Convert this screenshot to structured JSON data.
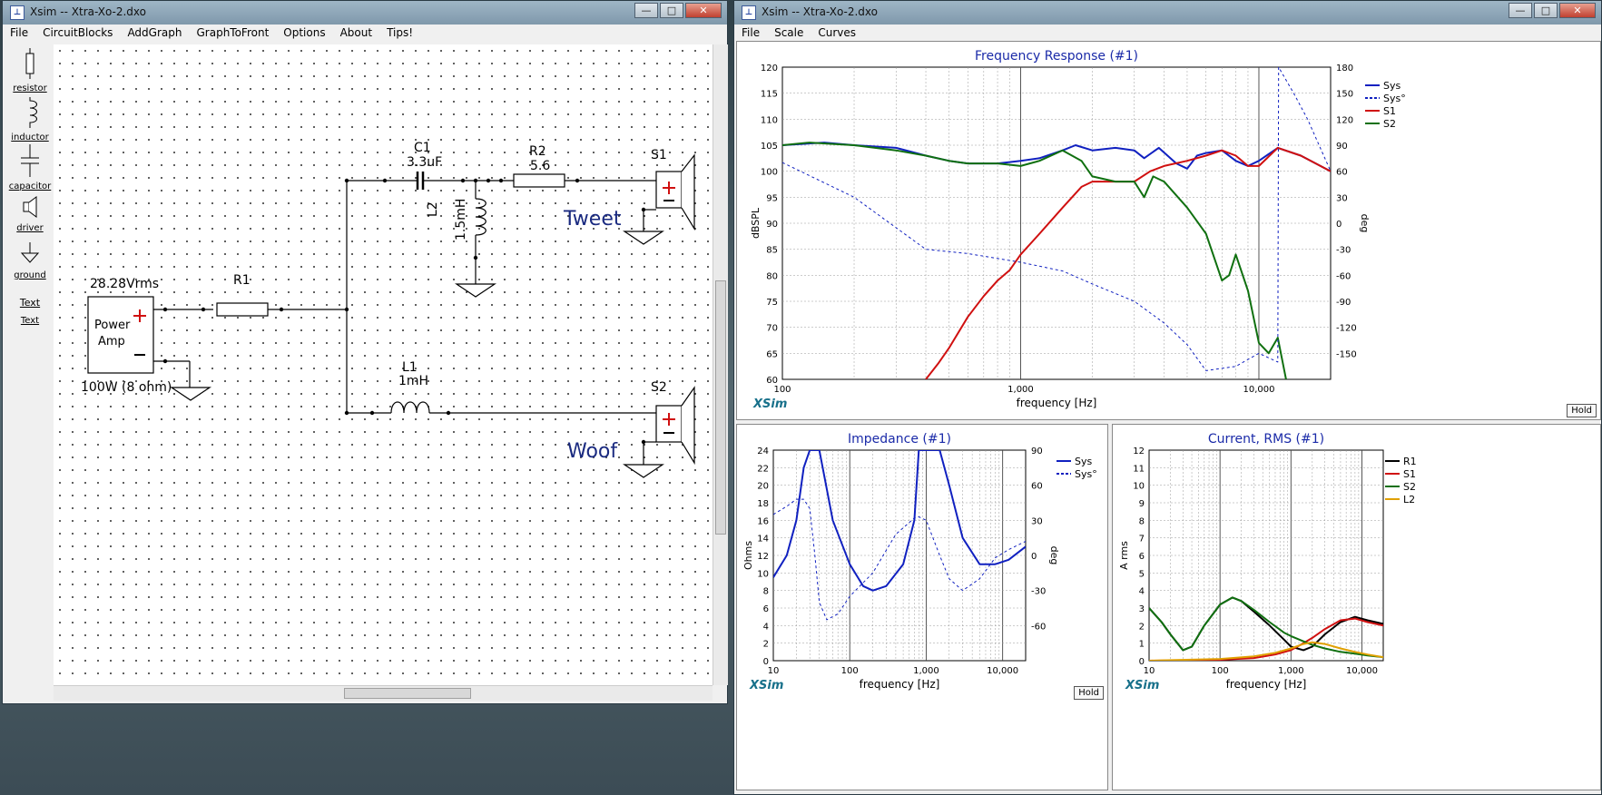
{
  "desktop": {
    "left_window_title": "Xsim -- Xtra-Xo-2.dxo",
    "right_window_title": "Xsim -- Xtra-Xo-2.dxo"
  },
  "left_menu": [
    "File",
    "CircuitBlocks",
    "AddGraph",
    "GraphToFront",
    "Options",
    "About",
    "Tips!"
  ],
  "right_menu": [
    "File",
    "Scale",
    "Curves"
  ],
  "window_buttons": {
    "minimize": "—",
    "maximize": "□",
    "close": "✕"
  },
  "toolbox": [
    "resistor",
    "inductor",
    "capacitor",
    "driver",
    "ground",
    "Text"
  ],
  "toolbox_text_sample": "Text",
  "schematic": {
    "source_voltage": "28.28Vrms",
    "source_name": "Power",
    "source_name2": "Amp",
    "source_rating": "100W (8 ohm)",
    "r1": "R1",
    "c1": "C1",
    "c1_value": "3.3uF",
    "r2": "R2",
    "r2_value": "5.6",
    "l2": "L2",
    "l2_value": "1.5mH",
    "l1": "L1",
    "l1_value": "1mH",
    "s1": "S1",
    "s2": "S2",
    "tweet": "Tweet",
    "woof": "Woof"
  },
  "freq_graph": {
    "title": "Frequency Response (#1)",
    "xlabel": "frequency [Hz]",
    "ylabel": "dBSPL",
    "y2label": "deg",
    "brand": "XSim",
    "hold": "Hold",
    "xticks": [
      "100",
      "1,000",
      "10,000"
    ],
    "yticks": [
      "120",
      "115",
      "110",
      "105",
      "100",
      "95",
      "90",
      "85",
      "80",
      "75",
      "70",
      "65",
      "60"
    ],
    "y2ticks": [
      "180",
      "150",
      "120",
      "90",
      "60",
      "30",
      "0",
      "-30",
      "-60",
      "-90",
      "-120",
      "-150"
    ],
    "legend": [
      "Sys",
      "Sys°",
      "S1",
      "S2"
    ]
  },
  "imp_graph": {
    "title": "Impedance (#1)",
    "xlabel": "frequency [Hz]",
    "ylabel": "Ohms",
    "y2label": "deg",
    "brand": "XSim",
    "hold": "Hold",
    "xticks": [
      "10",
      "100",
      "1,000",
      "10,000"
    ],
    "yticks": [
      "24",
      "22",
      "20",
      "18",
      "16",
      "14",
      "12",
      "10",
      "8",
      "6",
      "4",
      "2",
      "0"
    ],
    "y2ticks": [
      "90",
      "60",
      "30",
      "0",
      "-30",
      "-60"
    ],
    "legend": [
      "Sys",
      "Sys°"
    ]
  },
  "cur_graph": {
    "title": "Current, RMS (#1)",
    "xlabel": "frequency [Hz]",
    "ylabel": "A rms",
    "brand": "XSim",
    "xticks": [
      "10",
      "100",
      "1,000",
      "10,000"
    ],
    "yticks": [
      "12",
      "11",
      "10",
      "9",
      "8",
      "7",
      "6",
      "5",
      "4",
      "3",
      "2",
      "1",
      "0"
    ],
    "legend": [
      "R1",
      "S1",
      "S2",
      "L2"
    ]
  },
  "colors": {
    "sys": "#1020c0",
    "s1": "#d01010",
    "s2": "#107010",
    "l2": "#e0a000",
    "r1": "#000000",
    "title": "#1a2aa8"
  },
  "chart_data": [
    {
      "type": "line",
      "title": "Frequency Response (#1)",
      "xlabel": "frequency [Hz]",
      "ylabel": "dBSPL",
      "y2label": "deg",
      "xscale": "log",
      "xlim": [
        100,
        20000
      ],
      "ylim": [
        60,
        120
      ],
      "y2lim": [
        -180,
        180
      ],
      "legend": "top-right",
      "grid": true,
      "series": [
        {
          "name": "Sys",
          "axis": "left",
          "x": [
            100,
            150,
            200,
            300,
            400,
            500,
            600,
            800,
            1000,
            1200,
            1500,
            1700,
            2000,
            2500,
            3000,
            3300,
            3800,
            4500,
            5000,
            5500,
            6000,
            7000,
            8000,
            9000,
            10000,
            12000,
            15000,
            20000
          ],
          "y": [
            105,
            105.5,
            105,
            104.5,
            103,
            102,
            101.5,
            101.5,
            102,
            102.5,
            104,
            105,
            104,
            104.5,
            104,
            102.5,
            104.5,
            101.5,
            100.5,
            103,
            103.5,
            104,
            102,
            101,
            102,
            104.5,
            103,
            100
          ]
        },
        {
          "name": "S1",
          "axis": "left",
          "x": [
            400,
            450,
            500,
            600,
            700,
            800,
            900,
            1000,
            1200,
            1500,
            1800,
            2000,
            2500,
            3000,
            3500,
            4000,
            5000,
            6000,
            7000,
            8000,
            9000,
            10000,
            12000,
            15000,
            20000
          ],
          "y": [
            60,
            63,
            66,
            72,
            76,
            79,
            81,
            84,
            88,
            93,
            97,
            98,
            98,
            98,
            100,
            101,
            102,
            103,
            104,
            103,
            101,
            101,
            104.5,
            103,
            100
          ]
        },
        {
          "name": "S2",
          "axis": "left",
          "x": [
            100,
            130,
            200,
            300,
            400,
            500,
            600,
            800,
            1000,
            1200,
            1500,
            1800,
            2000,
            2500,
            3000,
            3300,
            3600,
            4000,
            5000,
            6000,
            7000,
            7500,
            8000,
            9000,
            10000,
            11000,
            12000,
            13000
          ],
          "y": [
            105,
            105.5,
            105,
            104,
            103,
            102,
            101.5,
            101.5,
            101,
            102,
            104,
            102,
            99,
            98,
            98,
            95,
            99,
            98,
            93,
            88,
            79,
            80,
            84,
            77,
            67,
            65,
            68,
            60
          ]
        },
        {
          "name": "Sys°",
          "axis": "right",
          "x": [
            100,
            200,
            400,
            600,
            1000,
            1500,
            2000,
            3000,
            4000,
            5000,
            6000,
            8000,
            10000,
            12000,
            12100,
            14000,
            16000,
            20000
          ],
          "y": [
            70,
            30,
            -30,
            -35,
            -45,
            -55,
            -70,
            -90,
            -115,
            -140,
            -170,
            -165,
            -150,
            -160,
            180,
            150,
            120,
            60
          ]
        }
      ]
    },
    {
      "type": "line",
      "title": "Impedance (#1)",
      "xlabel": "frequency [Hz]",
      "ylabel": "Ohms",
      "y2label": "deg",
      "xscale": "log",
      "xlim": [
        10,
        20000
      ],
      "ylim": [
        0,
        24
      ],
      "y2lim": [
        -90,
        90
      ],
      "legend": "top-right",
      "grid": true,
      "series": [
        {
          "name": "Sys",
          "axis": "left",
          "x": [
            10,
            15,
            20,
            25,
            30,
            40,
            60,
            100,
            150,
            200,
            300,
            500,
            700,
            800,
            1000,
            1500,
            2000,
            3000,
            5000,
            8000,
            12000,
            20000
          ],
          "y": [
            9.5,
            12,
            16,
            22,
            24,
            24,
            16,
            11,
            8.5,
            8,
            8.5,
            11,
            16,
            24,
            24,
            24,
            20,
            14,
            11,
            11,
            11.5,
            13
          ]
        },
        {
          "name": "Sys°",
          "axis": "right",
          "x": [
            10,
            15,
            20,
            25,
            30,
            35,
            40,
            50,
            70,
            100,
            200,
            400,
            700,
            800,
            1000,
            1500,
            2000,
            3000,
            5000,
            8000,
            12000,
            20000
          ],
          "y": [
            35,
            42,
            48,
            48,
            40,
            0,
            -40,
            -55,
            -50,
            -35,
            -15,
            18,
            32,
            33,
            30,
            0,
            -20,
            -30,
            -20,
            -2,
            5,
            12
          ]
        }
      ]
    },
    {
      "type": "line",
      "title": "Current, RMS (#1)",
      "xlabel": "frequency [Hz]",
      "ylabel": "A rms",
      "xscale": "log",
      "xlim": [
        10,
        20000
      ],
      "ylim": [
        0,
        12
      ],
      "legend": "top-right",
      "grid": true,
      "series": [
        {
          "name": "R1",
          "x": [
            10,
            15,
            20,
            30,
            40,
            60,
            100,
            150,
            200,
            300,
            500,
            800,
            1000,
            1500,
            2000,
            3000,
            5000,
            8000,
            12000,
            20000
          ],
          "y": [
            3,
            2.2,
            1.5,
            0.6,
            0.8,
            2,
            3.2,
            3.6,
            3.4,
            2.8,
            2,
            1.2,
            0.8,
            0.6,
            0.8,
            1.5,
            2.2,
            2.5,
            2.3,
            2.1
          ]
        },
        {
          "name": "S1",
          "x": [
            10,
            100,
            300,
            600,
            1000,
            1500,
            2000,
            3000,
            5000,
            8000,
            12000,
            20000
          ],
          "y": [
            0,
            0.05,
            0.15,
            0.35,
            0.6,
            1,
            1.3,
            1.8,
            2.3,
            2.4,
            2.2,
            2
          ]
        },
        {
          "name": "S2",
          "x": [
            10,
            15,
            20,
            30,
            40,
            60,
            100,
            150,
            200,
            300,
            500,
            800,
            1000,
            1500,
            2000,
            3000,
            5000,
            8000,
            12000,
            20000
          ],
          "y": [
            3,
            2.2,
            1.5,
            0.6,
            0.8,
            2,
            3.2,
            3.6,
            3.4,
            2.9,
            2.2,
            1.6,
            1.4,
            1.1,
            0.9,
            0.7,
            0.5,
            0.4,
            0.3,
            0.2
          ]
        },
        {
          "name": "L2",
          "x": [
            10,
            100,
            300,
            600,
            1000,
            1500,
            2000,
            3000,
            5000,
            8000,
            12000,
            20000
          ],
          "y": [
            0,
            0.1,
            0.25,
            0.45,
            0.7,
            0.95,
            1.05,
            0.95,
            0.7,
            0.5,
            0.35,
            0.2
          ]
        }
      ]
    }
  ]
}
